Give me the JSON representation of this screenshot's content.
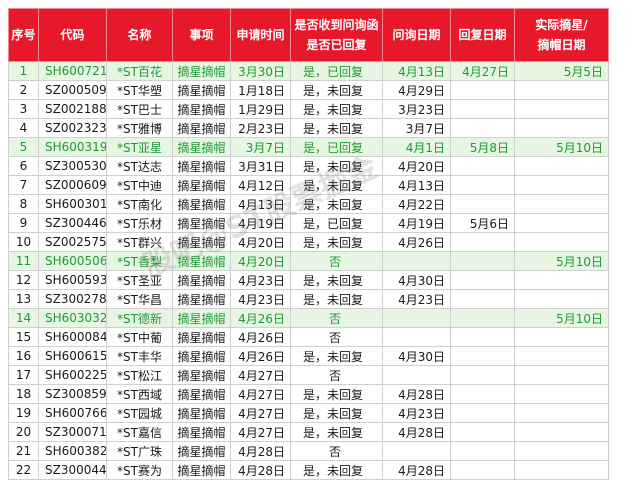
{
  "headers": {
    "idx": "序号",
    "code": "代码",
    "name": "名称",
    "item": "事项",
    "apply": "申请时间",
    "reply_q1": "是否收到问询函",
    "reply_q2": "是否已回复",
    "inquiry": "问询日期",
    "reply_date": "回复日期",
    "actual1": "实际摘星/",
    "actual2": "摘帽日期"
  },
  "rows": [
    {
      "idx": "1",
      "code": "SH600721",
      "name": "*ST百花",
      "item": "摘星摘帽",
      "apply": "3月30日",
      "status": "是，已回复",
      "inquiry": "4月13日",
      "reply": "4月27日",
      "actual": "5月5日",
      "hl": true
    },
    {
      "idx": "2",
      "code": "SZ000509",
      "name": "*ST华塑",
      "item": "摘星摘帽",
      "apply": "1月18日",
      "status": "是，未回复",
      "inquiry": "4月29日",
      "reply": "",
      "actual": "",
      "hl": false
    },
    {
      "idx": "3",
      "code": "SZ002188",
      "name": "*ST巴士",
      "item": "摘星摘帽",
      "apply": "1月29日",
      "status": "是，未回复",
      "inquiry": "3月23日",
      "reply": "",
      "actual": "",
      "hl": false
    },
    {
      "idx": "4",
      "code": "SZ002323",
      "name": "*ST雅博",
      "item": "摘星摘帽",
      "apply": "2月23日",
      "status": "是，未回复",
      "inquiry": "3月7日",
      "reply": "",
      "actual": "",
      "hl": false
    },
    {
      "idx": "5",
      "code": "SH600319",
      "name": "*ST亚星",
      "item": "摘星摘帽",
      "apply": "3月7日",
      "status": "是，已回复",
      "inquiry": "4月1日",
      "reply": "5月8日",
      "actual": "5月10日",
      "hl": true
    },
    {
      "idx": "6",
      "code": "SZ300530",
      "name": "*ST达志",
      "item": "摘星摘帽",
      "apply": "3月31日",
      "status": "是，未回复",
      "inquiry": "4月20日",
      "reply": "",
      "actual": "",
      "hl": false
    },
    {
      "idx": "7",
      "code": "SZ000609",
      "name": "*ST中迪",
      "item": "摘星摘帽",
      "apply": "4月12日",
      "status": "是，未回复",
      "inquiry": "4月13日",
      "reply": "",
      "actual": "",
      "hl": false
    },
    {
      "idx": "8",
      "code": "SH600301",
      "name": "*ST南化",
      "item": "摘星摘帽",
      "apply": "4月13日",
      "status": "是，未回复",
      "inquiry": "4月22日",
      "reply": "",
      "actual": "",
      "hl": false
    },
    {
      "idx": "9",
      "code": "SZ300446",
      "name": "*ST乐材",
      "item": "摘星摘帽",
      "apply": "4月19日",
      "status": "是，已回复",
      "inquiry": "4月19日",
      "reply": "5月6日",
      "actual": "",
      "hl": false
    },
    {
      "idx": "10",
      "code": "SZ002575",
      "name": "*ST群兴",
      "item": "摘星摘帽",
      "apply": "4月20日",
      "status": "是，未回复",
      "inquiry": "4月26日",
      "reply": "",
      "actual": "",
      "hl": false
    },
    {
      "idx": "11",
      "code": "SH600506",
      "name": "*ST香梨",
      "item": "摘星摘帽",
      "apply": "4月20日",
      "status": "否",
      "inquiry": "",
      "reply": "",
      "actual": "5月10日",
      "hl": true
    },
    {
      "idx": "12",
      "code": "SH600593",
      "name": "*ST圣亚",
      "item": "摘星摘帽",
      "apply": "4月23日",
      "status": "是，未回复",
      "inquiry": "4月30日",
      "reply": "",
      "actual": "",
      "hl": false
    },
    {
      "idx": "13",
      "code": "SZ300278",
      "name": "*ST华昌",
      "item": "摘星摘帽",
      "apply": "4月23日",
      "status": "是，未回复",
      "inquiry": "4月23日",
      "reply": "",
      "actual": "",
      "hl": false
    },
    {
      "idx": "14",
      "code": "SH603032",
      "name": "*ST德新",
      "item": "摘星摘帽",
      "apply": "4月26日",
      "status": "否",
      "inquiry": "",
      "reply": "",
      "actual": "5月10日",
      "hl": true
    },
    {
      "idx": "15",
      "code": "SH600084",
      "name": "*ST中葡",
      "item": "摘星摘帽",
      "apply": "4月26日",
      "status": "否",
      "inquiry": "",
      "reply": "",
      "actual": "",
      "hl": false
    },
    {
      "idx": "16",
      "code": "SH600615",
      "name": "*ST丰华",
      "item": "摘星摘帽",
      "apply": "4月26日",
      "status": "是，未回复",
      "inquiry": "4月30日",
      "reply": "",
      "actual": "",
      "hl": false
    },
    {
      "idx": "17",
      "code": "SH600225",
      "name": "*ST松江",
      "item": "摘星摘帽",
      "apply": "4月27日",
      "status": "否",
      "inquiry": "",
      "reply": "",
      "actual": "",
      "hl": false
    },
    {
      "idx": "18",
      "code": "SZ300859",
      "name": "*ST西域",
      "item": "摘星摘帽",
      "apply": "4月27日",
      "status": "是，未回复",
      "inquiry": "4月28日",
      "reply": "",
      "actual": "",
      "hl": false
    },
    {
      "idx": "19",
      "code": "SH600766",
      "name": "*ST园城",
      "item": "摘星摘帽",
      "apply": "4月27日",
      "status": "是，未回复",
      "inquiry": "4月23日",
      "reply": "",
      "actual": "",
      "hl": false
    },
    {
      "idx": "20",
      "code": "SZ300071",
      "name": "*ST嘉信",
      "item": "摘星摘帽",
      "apply": "4月27日",
      "status": "是，未回复",
      "inquiry": "4月28日",
      "reply": "",
      "actual": "",
      "hl": false
    },
    {
      "idx": "21",
      "code": "SH600382",
      "name": "*ST广珠",
      "item": "摘星摘帽",
      "apply": "4月28日",
      "status": "否",
      "inquiry": "",
      "reply": "",
      "actual": "",
      "hl": false
    },
    {
      "idx": "22",
      "code": "SZ300044",
      "name": "*ST赛为",
      "item": "摘星摘帽",
      "apply": "4月28日",
      "status": "是，未回复",
      "inquiry": "4月28日",
      "reply": "",
      "actual": "",
      "hl": false
    }
  ],
  "watermark": "股吧@ST股票掘金"
}
